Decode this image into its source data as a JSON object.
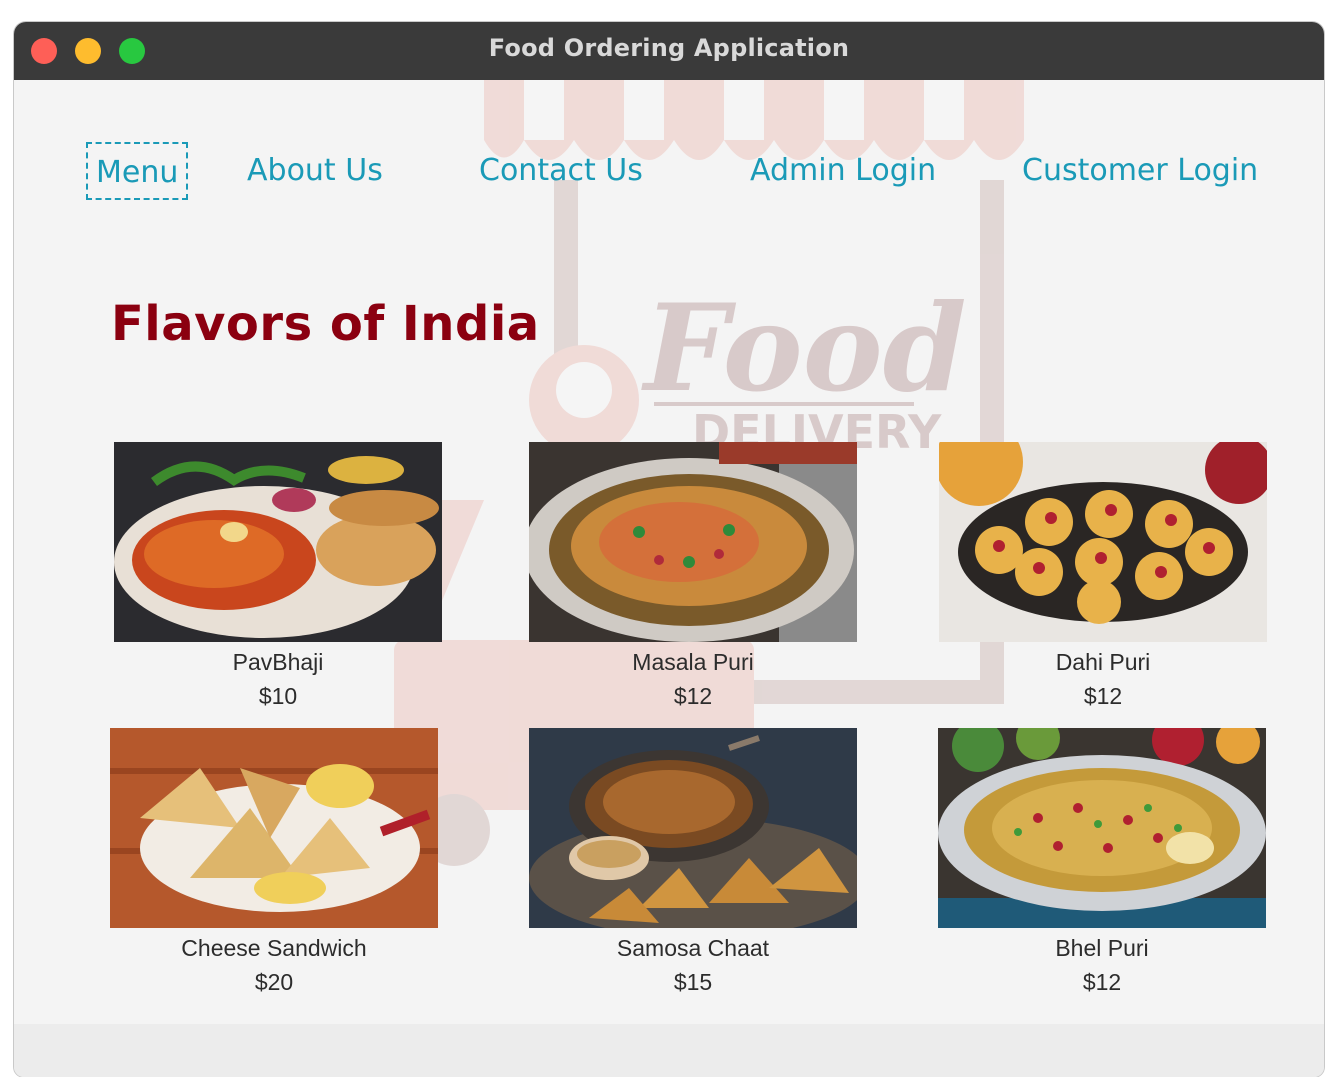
{
  "window": {
    "title": "Food Ordering Application"
  },
  "nav": {
    "items": [
      {
        "label": "Menu",
        "active": true
      },
      {
        "label": "About Us",
        "active": false
      },
      {
        "label": "Contact Us",
        "active": false
      },
      {
        "label": "Admin Login",
        "active": false
      },
      {
        "label": "Customer Login",
        "active": false
      }
    ]
  },
  "watermark": {
    "word": "Food",
    "sub": "DELIVERY"
  },
  "headline": "Flavors of India",
  "menu": {
    "items": [
      {
        "name": "PavBhaji",
        "price": "$10",
        "image": "pav-bhaji-photo"
      },
      {
        "name": "Masala Puri",
        "price": "$12",
        "image": "masala-puri-photo"
      },
      {
        "name": "Dahi Puri",
        "price": "$12",
        "image": "dahi-puri-photo"
      },
      {
        "name": "Cheese Sandwich",
        "price": "$20",
        "image": "cheese-sandwich-photo"
      },
      {
        "name": "Samosa Chaat",
        "price": "$15",
        "image": "samosa-chaat-photo"
      },
      {
        "name": "Bhel Puri",
        "price": "$12",
        "image": "bhel-puri-photo"
      }
    ]
  },
  "colors": {
    "nav_text": "#1a9ab7",
    "headline": "#8b0010",
    "titlebar": "#3a3a3a",
    "close": "#fe5f57",
    "minimize": "#febc2e",
    "maximize": "#28c840"
  }
}
